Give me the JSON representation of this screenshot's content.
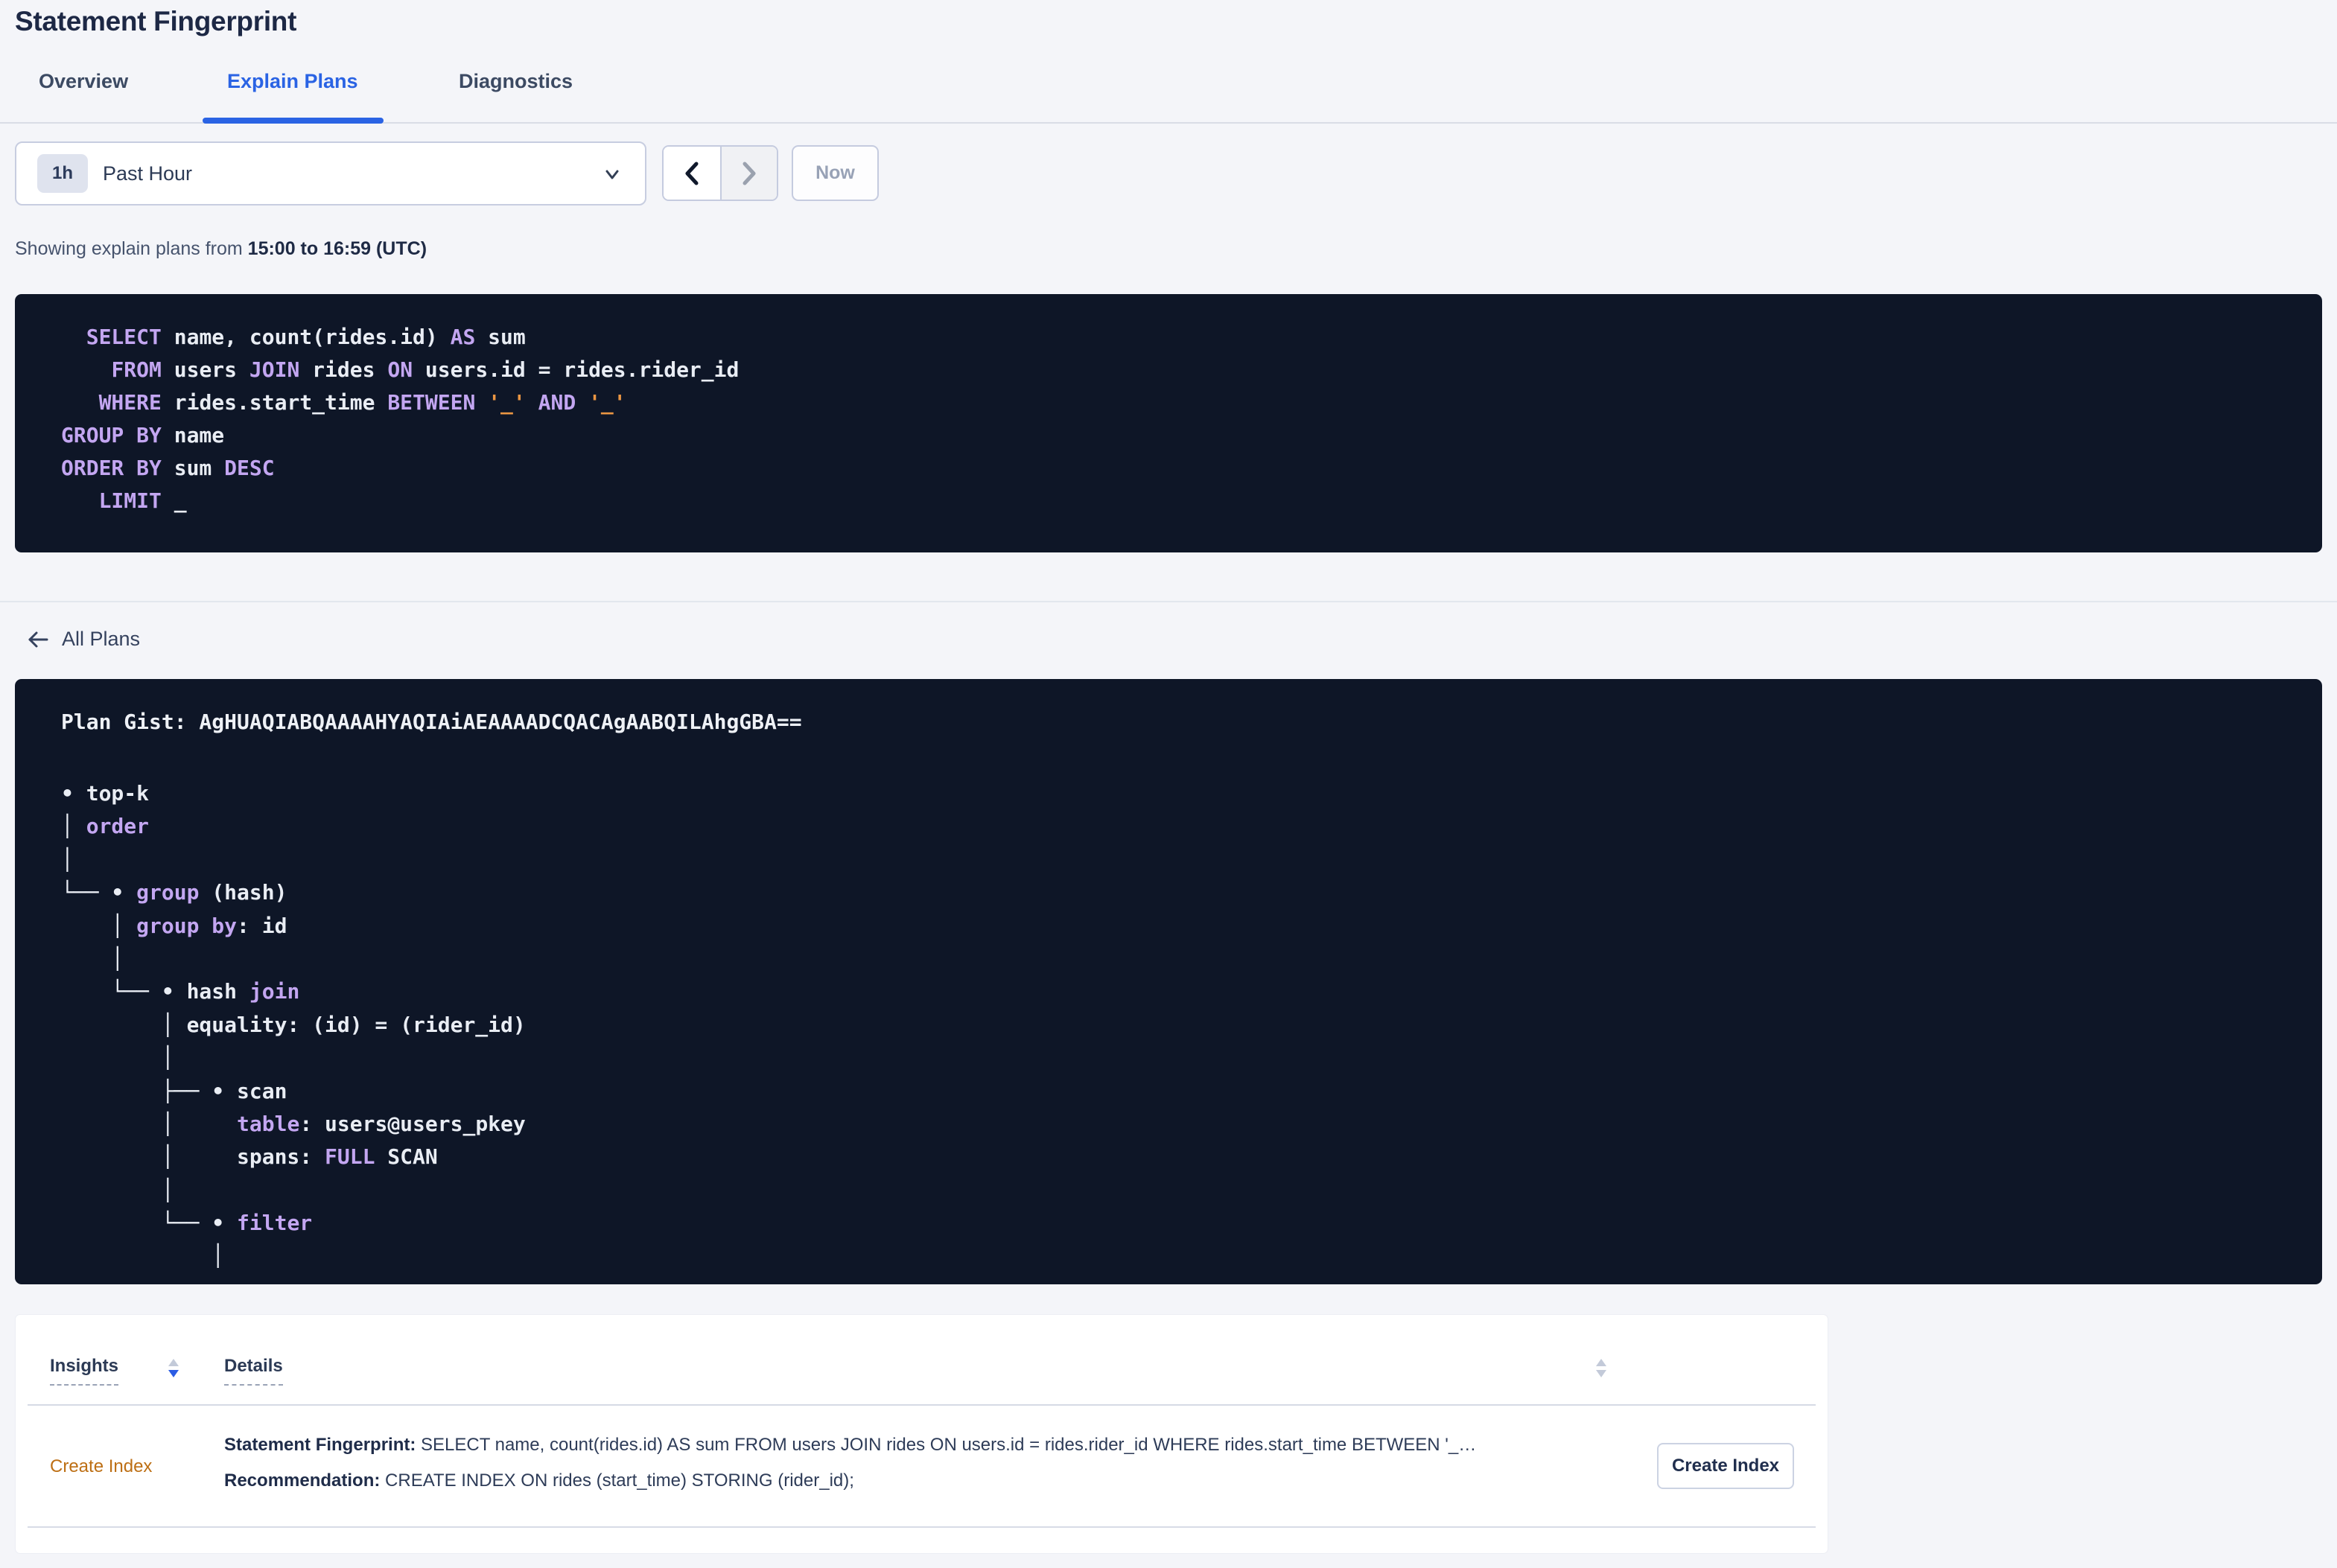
{
  "page": {
    "title": "Statement Fingerprint"
  },
  "tabs": [
    {
      "label": "Overview",
      "active": false
    },
    {
      "label": "Explain Plans",
      "active": true
    },
    {
      "label": "Diagnostics",
      "active": false
    }
  ],
  "time_picker": {
    "badge": "1h",
    "selected": "Past Hour",
    "now_label": "Now"
  },
  "showing": {
    "prefix": "Showing explain plans from ",
    "range": "15:00 to 16:59 (UTC)"
  },
  "sql": {
    "lines": [
      [
        [
          "t",
          "  "
        ],
        [
          "k",
          "SELECT"
        ],
        [
          "t",
          " name, count(rides.id) "
        ],
        [
          "k",
          "AS"
        ],
        [
          "t",
          " sum"
        ]
      ],
      [
        [
          "t",
          "    "
        ],
        [
          "k",
          "FROM"
        ],
        [
          "t",
          " users "
        ],
        [
          "k",
          "JOIN"
        ],
        [
          "t",
          " rides "
        ],
        [
          "k",
          "ON"
        ],
        [
          "t",
          " users.id = rides.rider_id"
        ]
      ],
      [
        [
          "t",
          "   "
        ],
        [
          "k",
          "WHERE"
        ],
        [
          "t",
          " rides.start_time "
        ],
        [
          "k",
          "BETWEEN"
        ],
        [
          "t",
          " "
        ],
        [
          "s",
          "'_'"
        ],
        [
          "t",
          " "
        ],
        [
          "k",
          "AND"
        ],
        [
          "t",
          " "
        ],
        [
          "s",
          "'_'"
        ]
      ],
      [
        [
          "k",
          "GROUP BY"
        ],
        [
          "t",
          " name"
        ]
      ],
      [
        [
          "k",
          "ORDER BY"
        ],
        [
          "t",
          " sum "
        ],
        [
          "k",
          "DESC"
        ]
      ],
      [
        [
          "t",
          "   "
        ],
        [
          "k",
          "LIMIT"
        ],
        [
          "t",
          " _"
        ]
      ]
    ]
  },
  "all_plans": {
    "label": "All Plans"
  },
  "plan": {
    "gist": "Plan Gist: AgHUAQIABQAAAAHYAQIAiAEAAAADCQACAgAABQILAhgGBA==",
    "tree": [
      [
        [
          "t",
          "• top-k"
        ]
      ],
      [
        [
          "t",
          "│ "
        ],
        [
          "k",
          "order"
        ]
      ],
      [
        [
          "t",
          "│"
        ]
      ],
      [
        [
          "t",
          "└── • "
        ],
        [
          "k",
          "group"
        ],
        [
          "t",
          " (hash)"
        ]
      ],
      [
        [
          "t",
          "    │ "
        ],
        [
          "k",
          "group by"
        ],
        [
          "t",
          ": id"
        ]
      ],
      [
        [
          "t",
          "    │"
        ]
      ],
      [
        [
          "t",
          "    └── • hash "
        ],
        [
          "k",
          "join"
        ]
      ],
      [
        [
          "t",
          "        │ equality: (id) = (rider_id)"
        ]
      ],
      [
        [
          "t",
          "        │"
        ]
      ],
      [
        [
          "t",
          "        ├── • scan"
        ]
      ],
      [
        [
          "t",
          "        │     "
        ],
        [
          "k",
          "table"
        ],
        [
          "t",
          ": users@users_pkey"
        ]
      ],
      [
        [
          "t",
          "        │     spans: "
        ],
        [
          "k",
          "FULL"
        ],
        [
          "t",
          " SCAN"
        ]
      ],
      [
        [
          "t",
          "        │"
        ]
      ],
      [
        [
          "t",
          "        └── • "
        ],
        [
          "k",
          "filter"
        ]
      ],
      [
        [
          "t",
          "            │"
        ]
      ]
    ]
  },
  "insights_table": {
    "columns": {
      "insights": "Insights",
      "details": "Details"
    },
    "row": {
      "insight_link": "Create Index",
      "fingerprint_label": "Statement Fingerprint: ",
      "fingerprint_text": "SELECT name, count(rides.id) AS sum FROM users JOIN rides ON users.id = rides.rider_id WHERE rides.start_time BETWEEN '_…",
      "recommendation_label": "Recommendation: ",
      "recommendation_text": "CREATE INDEX ON rides (start_time) STORING (rider_id);",
      "action_button": "Create Index"
    }
  },
  "colors": {
    "accent_blue": "#2a63e4",
    "keyword_purple": "#c3a6f1",
    "string_orange": "#eb9643",
    "insight_link_orange": "#bd6f14",
    "code_background": "#0e1627",
    "page_background": "#f4f5f9"
  }
}
